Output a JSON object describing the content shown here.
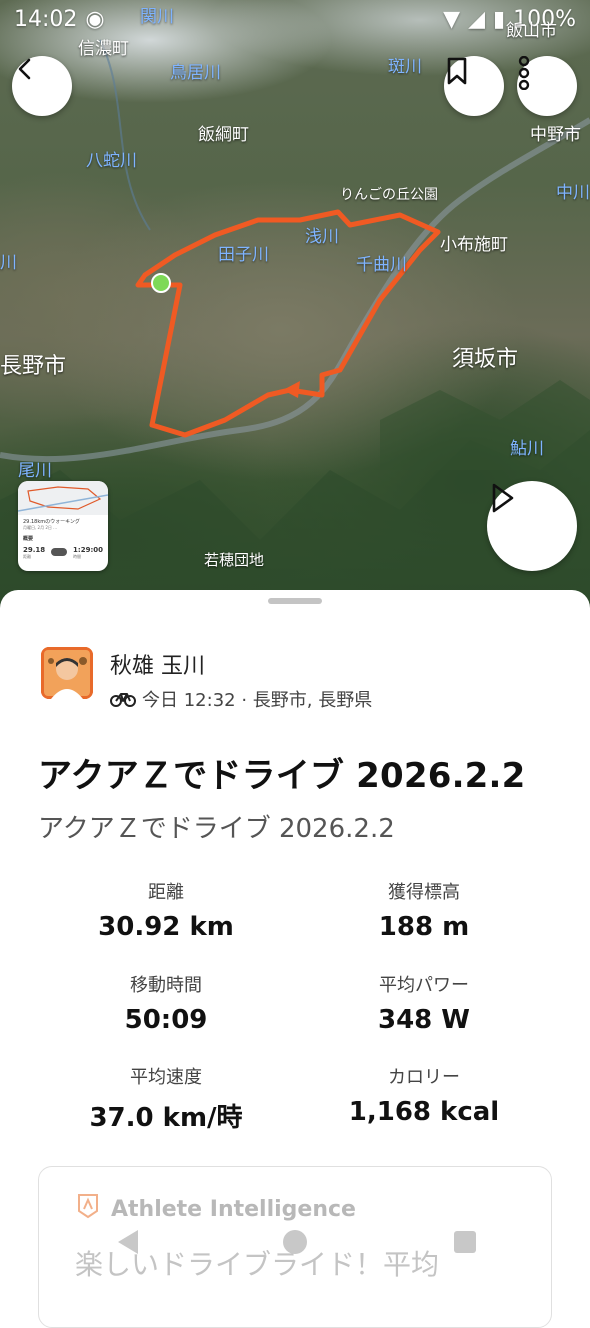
{
  "status_bar": {
    "time": "14:02",
    "battery": "100%"
  },
  "map": {
    "place_labels": {
      "shinano": "信濃町",
      "iiyama": "飯山市",
      "iizuna": "飯綱町",
      "nakano": "中野市",
      "ringo": "りんごの丘公園",
      "obuse": "小布施町",
      "nagano": "長野市",
      "suzaka": "須坂市",
      "wakaho": "若穂団地"
    },
    "river_labels": {
      "sekigawa": "関川",
      "torii": "鳥居川",
      "hachija": "八蛇川",
      "madara": "斑川",
      "nakagawa": "中川",
      "tagogawa": "田子川",
      "asakawa": "浅川",
      "chikuma": "千曲川",
      "ayu": "鮎川",
      "oro": "尾川",
      "left_river": "川"
    }
  },
  "thumbnail": {
    "title": "29.18kmのウォーキング",
    "date": "月曜日, 2月 2日 …",
    "section": "概要",
    "distance": "29.18",
    "distance_label": "距離",
    "time": "1:29:00",
    "time_label": "時間"
  },
  "activity": {
    "athlete_name": "秋雄 玉川",
    "meta": "今日 12:32 · 長野市, 長野県",
    "title": "アクアＺでドライブ 2026.2.2",
    "description": "アクアＺでドライブ 2026.2.2"
  },
  "stats": [
    {
      "label": "距離",
      "value": "30.92 km"
    },
    {
      "label": "獲得標高",
      "value": "188 m"
    },
    {
      "label": "移動時間",
      "value": "50:09"
    },
    {
      "label": "平均パワー",
      "value": "348 W"
    },
    {
      "label": "平均速度",
      "value": "37.0 km/時"
    },
    {
      "label": "カロリー",
      "value": "1,168 kcal"
    }
  ],
  "athlete_intelligence": {
    "title": "Athlete Intelligence",
    "text": "楽しいドライブライド！平均"
  },
  "colors": {
    "route": "#f05a23",
    "start_marker": "#7ed957",
    "brand": "#fc5200"
  }
}
